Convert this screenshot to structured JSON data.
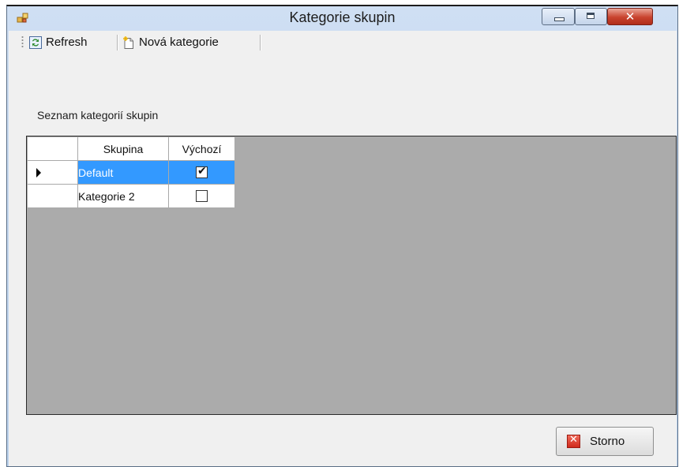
{
  "window": {
    "title": "Kategorie skupin",
    "close_glyph": "✕"
  },
  "toolbar": {
    "refresh_label": "Refresh",
    "new_category_label": "Nová kategorie"
  },
  "list_label": "Seznam kategorií skupin",
  "grid": {
    "columns": [
      "Skupina",
      "Výchozí"
    ],
    "rows": [
      {
        "skupina": "Default",
        "vychozi": true,
        "selected": true
      },
      {
        "skupina": "Kategorie 2",
        "vychozi": false,
        "selected": false
      }
    ],
    "check_glyph": "✔"
  },
  "footer": {
    "cancel_label": "Storno",
    "cancel_glyph": "✕"
  },
  "colors": {
    "selection": "#3399ff",
    "grid_background": "#ababab"
  }
}
